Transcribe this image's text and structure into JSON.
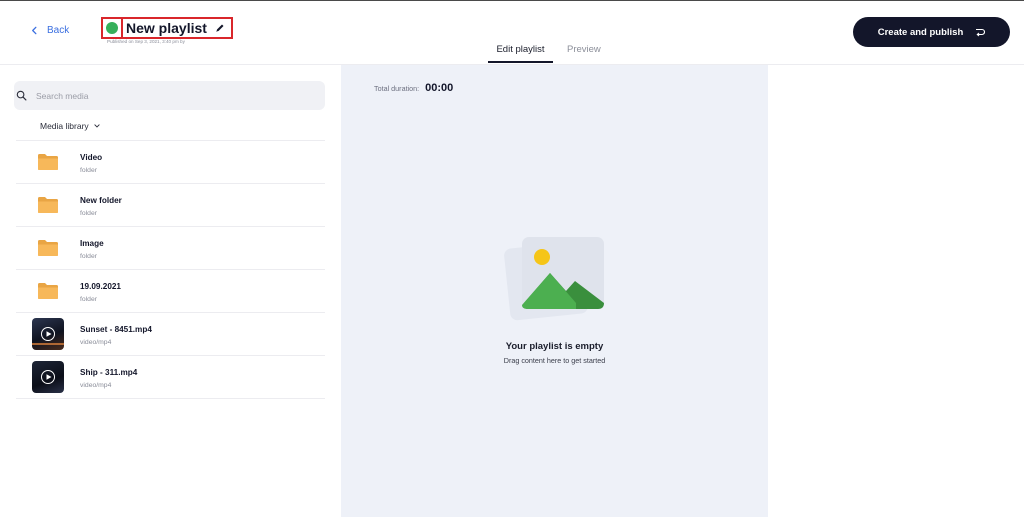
{
  "header": {
    "back_label": "Back",
    "title": "New playlist",
    "published": "Published on Sep 3, 2021, 3:40 pm by",
    "tabs": [
      {
        "label": "Edit playlist",
        "active": true
      },
      {
        "label": "Preview",
        "active": false
      }
    ],
    "create_label": "Create and publish"
  },
  "search": {
    "placeholder": "Search media"
  },
  "library": {
    "label": "Media library"
  },
  "media": [
    {
      "name": "Video",
      "type": "folder",
      "kind": "folder-icon"
    },
    {
      "name": "New folder",
      "type": "folder",
      "kind": "folder-icon"
    },
    {
      "name": "Image",
      "type": "folder",
      "kind": "folder-icon"
    },
    {
      "name": "19.09.2021",
      "type": "folder",
      "kind": "folder-icon"
    },
    {
      "name": "Sunset - 8451.mp4",
      "type": "video/mp4",
      "kind": "video-thumbnail"
    },
    {
      "name": "Ship - 311.mp4",
      "type": "video/mp4",
      "kind": "video-thumbnail"
    }
  ],
  "playlist": {
    "duration_label": "Total duration:",
    "duration_value": "00:00",
    "empty_title": "Your playlist is empty",
    "empty_subtitle": "Drag content here to get started"
  },
  "colors": {
    "accent_dark": "#13162a",
    "link_blue": "#3b6fe0",
    "status_green": "#36b05b",
    "highlight_red": "#d9262b",
    "folder_orange": "#f7b85a",
    "panel_bg": "#eef1f8"
  }
}
